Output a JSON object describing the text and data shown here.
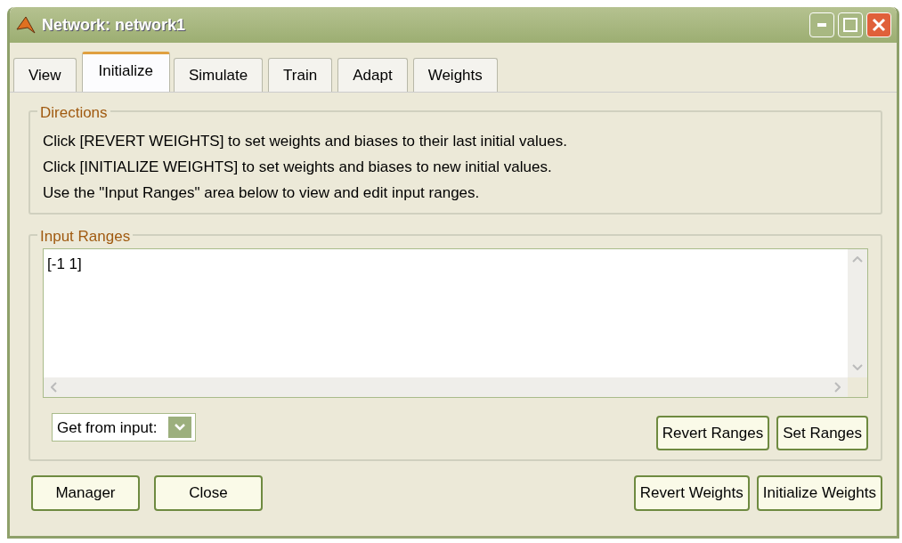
{
  "window": {
    "title": "Network: network1"
  },
  "tabs": [
    {
      "label": "View",
      "selected": false
    },
    {
      "label": "Initialize",
      "selected": true
    },
    {
      "label": "Simulate",
      "selected": false
    },
    {
      "label": "Train",
      "selected": false
    },
    {
      "label": "Adapt",
      "selected": false
    },
    {
      "label": "Weights",
      "selected": false
    }
  ],
  "directions": {
    "title": "Directions",
    "lines": [
      "Click [REVERT WEIGHTS] to set weights and biases to their last initial values.",
      "Click [INITIALIZE WEIGHTS] to set weights and biases to new initial values.",
      "Use the \"Input Ranges\" area below to view and edit input ranges."
    ]
  },
  "input_ranges": {
    "title": "Input Ranges",
    "value": "[-1 1]",
    "source": "Get from input:",
    "buttons": [
      "Revert Ranges",
      "Set Ranges"
    ]
  },
  "footer": {
    "left_buttons": [
      "Manager",
      "Close"
    ],
    "right_buttons": [
      "Revert Weights",
      "Initialize Weights"
    ]
  }
}
